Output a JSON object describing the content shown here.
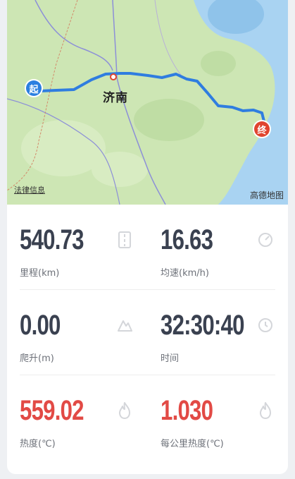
{
  "map": {
    "city": "济南",
    "start_marker": "起",
    "end_marker": "终",
    "legal": "法律信息",
    "provider": "高德地图",
    "route_color": "#2f7de0"
  },
  "stats": [
    {
      "value": "540.73",
      "label": "里程(km)",
      "icon": "road-icon",
      "color": "#3a4150"
    },
    {
      "value": "16.63",
      "label": "均速(km/h)",
      "icon": "speedometer-icon",
      "color": "#3a4150"
    },
    {
      "value": "0.00",
      "label": "爬升(m)",
      "icon": "elevation-icon",
      "color": "#3a4150"
    },
    {
      "value": "32:30:40",
      "label": "时间",
      "icon": "clock-icon",
      "color": "#3a4150"
    },
    {
      "value": "559.02",
      "label": "热度(℃)",
      "icon": "flame-icon",
      "color": "#e24a45"
    },
    {
      "value": "1.030",
      "label": "每公里热度(℃)",
      "icon": "flame-icon",
      "color": "#e24a45"
    }
  ]
}
